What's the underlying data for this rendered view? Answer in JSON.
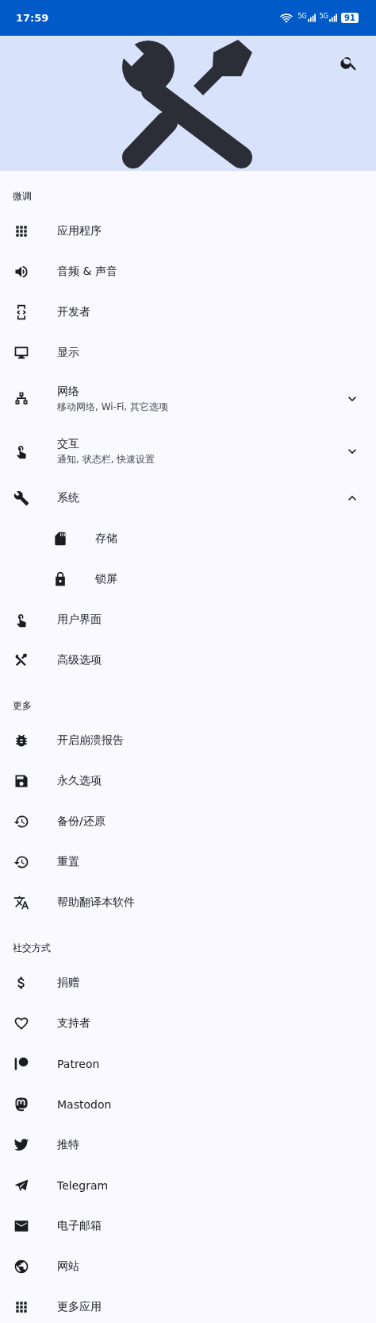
{
  "status_bar": {
    "time": "17:59",
    "networks": [
      "5G",
      "5G"
    ],
    "battery": "91"
  },
  "sections": [
    {
      "title": "微调",
      "items": [
        {
          "label": "应用程序"
        },
        {
          "label": "音频 & 声音"
        },
        {
          "label": "开发者"
        },
        {
          "label": "显示"
        },
        {
          "label": "网络",
          "subtitle": "移动网络, Wi-Fi, 其它选项",
          "expanded": false
        },
        {
          "label": "交互",
          "subtitle": "通知, 状态栏, 快速设置",
          "expanded": false
        },
        {
          "label": "系统",
          "expanded": true,
          "children": [
            {
              "label": "存储"
            },
            {
              "label": "锁屏"
            }
          ]
        },
        {
          "label": "用户界面"
        },
        {
          "label": "高级选项"
        }
      ]
    },
    {
      "title": "更多",
      "items": [
        {
          "label": "开启崩溃报告"
        },
        {
          "label": "永久选项"
        },
        {
          "label": "备份/还原"
        },
        {
          "label": "重置"
        },
        {
          "label": "帮助翻译本软件"
        }
      ]
    },
    {
      "title": "社交方式",
      "items": [
        {
          "label": "捐赠"
        },
        {
          "label": "支持者"
        },
        {
          "label": "Patreon"
        },
        {
          "label": "Mastodon"
        },
        {
          "label": "推特"
        },
        {
          "label": "Telegram"
        },
        {
          "label": "电子邮箱"
        },
        {
          "label": "网站"
        },
        {
          "label": "更多应用"
        }
      ]
    }
  ]
}
